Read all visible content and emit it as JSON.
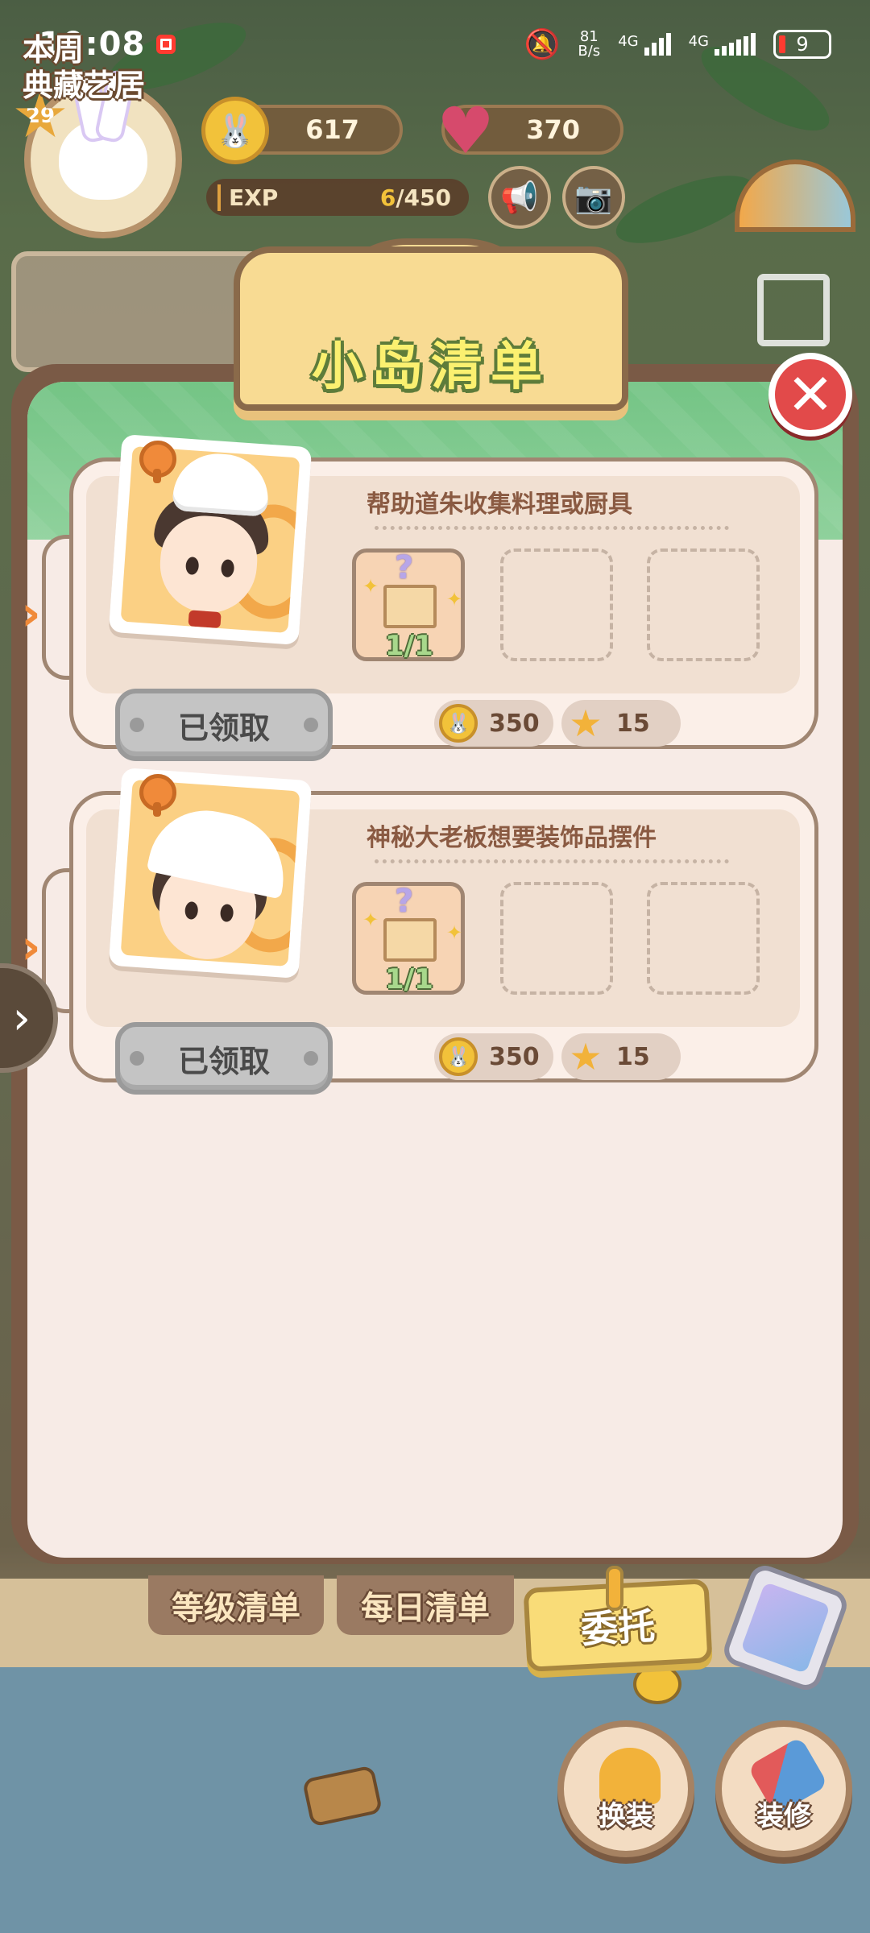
{
  "status_bar": {
    "time": "10:08",
    "net_speed_value": "81",
    "net_speed_unit": "B/s",
    "signal1_label": "4G",
    "signal2_label": "4G",
    "battery": "9"
  },
  "hud": {
    "level": "29",
    "coins": "617",
    "hearts": "370",
    "exp_label": "EXP",
    "exp_current": "6",
    "exp_max": "/450",
    "weekly_label_line1": "本周",
    "weekly_label_line2": "典藏艺居"
  },
  "dialog": {
    "title": "小岛清单",
    "close_icon": "close-icon"
  },
  "tasks": [
    {
      "title": "帮助道朱收集料理或厨具",
      "portrait": "chef-boy",
      "slot_progress": "1/1",
      "button_label": "已领取",
      "reward_coins": "350",
      "reward_stars": "15"
    },
    {
      "title": "神秘大老板想要装饰品摆件",
      "portrait": "headscarf-girl",
      "slot_progress": "1/1",
      "button_label": "已领取",
      "reward_coins": "350",
      "reward_stars": "15"
    }
  ],
  "bottom_tabs": {
    "level_list": "等级清单",
    "daily_list": "每日清单",
    "commission": "委托"
  },
  "actions": {
    "dress_up": "换装",
    "decorate": "装修"
  },
  "colors": {
    "dialog_frame": "#7a5a46",
    "title_text": "#fbf070",
    "close_button": "#e24a4a",
    "header_band": "#74c485",
    "active_tab": "#f9dc78"
  }
}
